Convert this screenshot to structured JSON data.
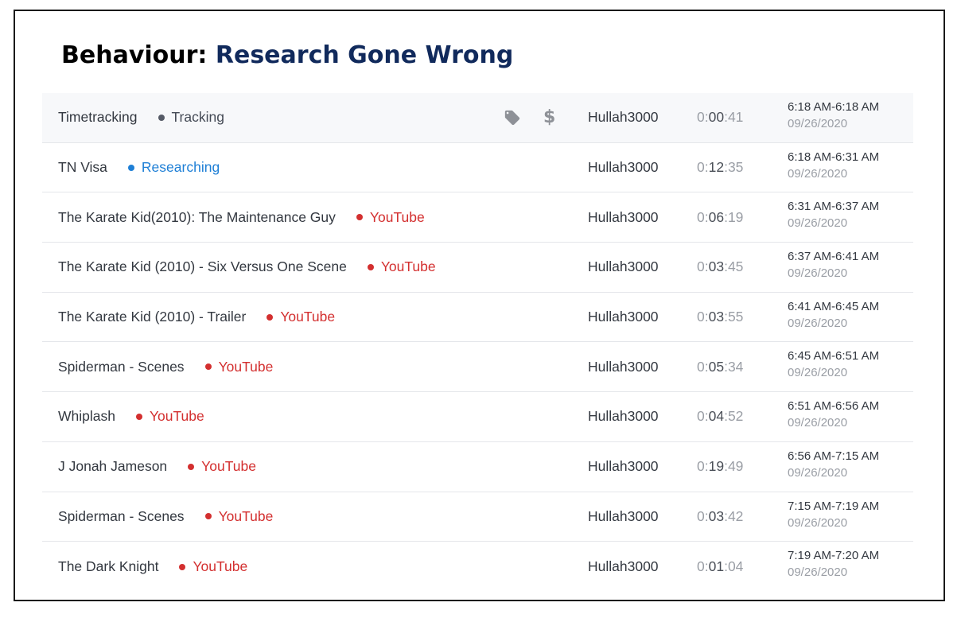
{
  "heading": {
    "prefix": "Behaviour:",
    "accent": "Research Gone Wrong"
  },
  "colors": {
    "heading_accent": "#112a5c",
    "tracking": "#555a66",
    "researching": "#1e7fd6",
    "youtube": "#d32f2f"
  },
  "rows": [
    {
      "title": "Timetracking",
      "project": "Tracking",
      "project_type": "tracking",
      "show_icons": true,
      "user": "Hullah3000",
      "dur_prefix": "0:",
      "dur_main": "00",
      "dur_sec": ":41",
      "range": "6:18 AM-6:18 AM",
      "date": "09/26/2020"
    },
    {
      "title": "TN Visa",
      "project": "Researching",
      "project_type": "researching",
      "show_icons": false,
      "user": "Hullah3000",
      "dur_prefix": "0:",
      "dur_main": "12",
      "dur_sec": ":35",
      "range": "6:18 AM-6:31 AM",
      "date": "09/26/2020"
    },
    {
      "title": "The Karate Kid(2010): The Maintenance Guy",
      "project": "YouTube",
      "project_type": "youtube",
      "show_icons": false,
      "user": "Hullah3000",
      "dur_prefix": "0:",
      "dur_main": "06",
      "dur_sec": ":19",
      "range": "6:31 AM-6:37 AM",
      "date": "09/26/2020"
    },
    {
      "title": "The Karate Kid (2010) - Six Versus One Scene",
      "project": "YouTube",
      "project_type": "youtube",
      "show_icons": false,
      "user": "Hullah3000",
      "dur_prefix": "0:",
      "dur_main": "03",
      "dur_sec": ":45",
      "range": "6:37 AM-6:41 AM",
      "date": "09/26/2020"
    },
    {
      "title": "The Karate Kid (2010) - Trailer",
      "project": "YouTube",
      "project_type": "youtube",
      "show_icons": false,
      "user": "Hullah3000",
      "dur_prefix": "0:",
      "dur_main": "03",
      "dur_sec": ":55",
      "range": "6:41 AM-6:45 AM",
      "date": "09/26/2020"
    },
    {
      "title": "Spiderman - Scenes",
      "project": "YouTube",
      "project_type": "youtube",
      "show_icons": false,
      "user": "Hullah3000",
      "dur_prefix": "0:",
      "dur_main": "05",
      "dur_sec": ":34",
      "range": "6:45 AM-6:51 AM",
      "date": "09/26/2020"
    },
    {
      "title": "Whiplash",
      "project": "YouTube",
      "project_type": "youtube",
      "show_icons": false,
      "user": "Hullah3000",
      "dur_prefix": "0:",
      "dur_main": "04",
      "dur_sec": ":52",
      "range": "6:51 AM-6:56 AM",
      "date": "09/26/2020"
    },
    {
      "title": "J Jonah Jameson",
      "project": "YouTube",
      "project_type": "youtube",
      "show_icons": false,
      "user": "Hullah3000",
      "dur_prefix": "0:",
      "dur_main": "19",
      "dur_sec": ":49",
      "range": "6:56 AM-7:15 AM",
      "date": "09/26/2020"
    },
    {
      "title": "Spiderman - Scenes",
      "project": "YouTube",
      "project_type": "youtube",
      "show_icons": false,
      "user": "Hullah3000",
      "dur_prefix": "0:",
      "dur_main": "03",
      "dur_sec": ":42",
      "range": "7:15 AM-7:19 AM",
      "date": "09/26/2020"
    },
    {
      "title": "The Dark Knight",
      "project": "YouTube",
      "project_type": "youtube",
      "show_icons": false,
      "user": "Hullah3000",
      "dur_prefix": "0:",
      "dur_main": "01",
      "dur_sec": ":04",
      "range": "7:19 AM-7:20 AM",
      "date": "09/26/2020"
    }
  ],
  "icons": {
    "tag": "tag-icon",
    "billable": "dollar-icon",
    "dollar_glyph": "$"
  }
}
